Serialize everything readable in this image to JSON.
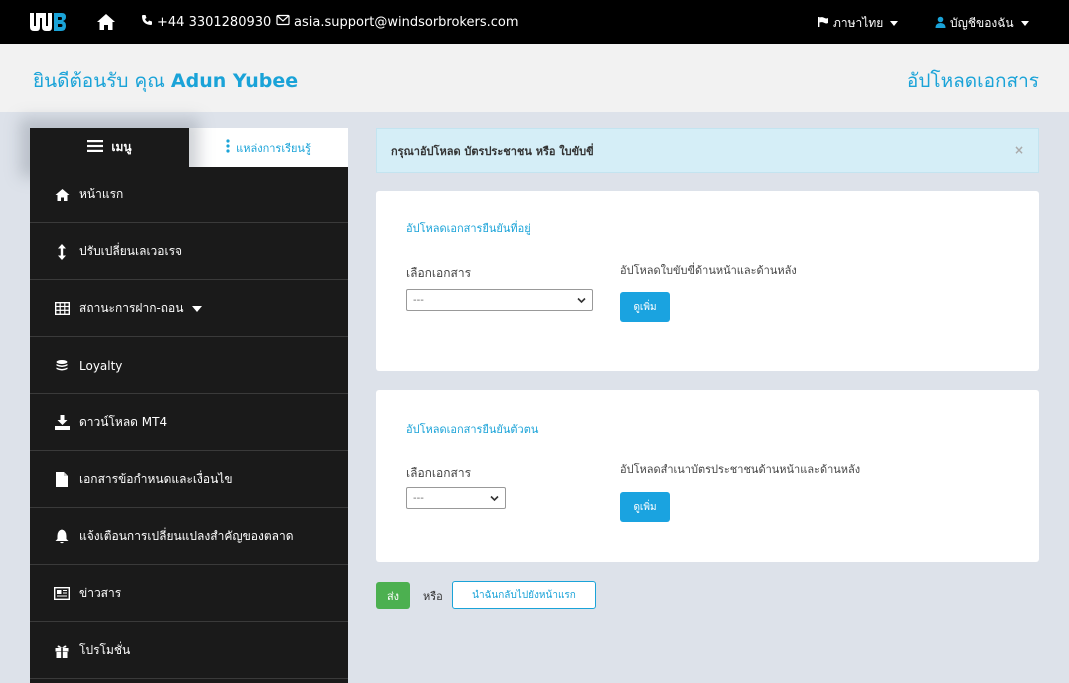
{
  "topbar": {
    "logo_text": "WB",
    "phone": "+44 3301280930",
    "email": "asia.support@windsorbrokers.com",
    "language": "ภาษาไทย",
    "account": "บัญชีของฉัน"
  },
  "welcome": {
    "greeting": "ยินดีต้อนรับ คุณ",
    "name": "Adun Yubee",
    "page_title": "อัปโหลดเอกสาร"
  },
  "sidebar": {
    "tab_menu": "เมนู",
    "tab_learning": "แหล่งการเรียนรู้",
    "items": [
      {
        "label": "หน้าแรก",
        "icon": "home-icon"
      },
      {
        "label": "ปรับเปลี่ยนเลเวอเรจ",
        "icon": "vertical-arrows-icon"
      },
      {
        "label": "สถานะการฝาก-ถอน",
        "icon": "table-icon"
      },
      {
        "label": "Loyalty",
        "icon": "coins-icon"
      },
      {
        "label": "ดาวน์โหลด MT4",
        "icon": "download-icon"
      },
      {
        "label": "เอกสารข้อกำหนดและเงื่อนไข",
        "icon": "file-icon"
      },
      {
        "label": "แจ้งเตือนการเปลี่ยนแปลงสำคัญของตลาด",
        "icon": "bell-icon"
      },
      {
        "label": "ข่าวสาร",
        "icon": "newspaper-icon"
      },
      {
        "label": "โปรโมชั่น",
        "icon": "gift-icon"
      }
    ]
  },
  "alert": {
    "message": "กรุณาอัปโหลด บัตรประชาชน หรือ ใบขับขี่",
    "close": "×"
  },
  "cards": [
    {
      "title": "อัปโหลดเอกสารยืนยันที่อยู่",
      "select_label": "เลือกเอกสาร",
      "select_value": "---",
      "upload_label": "อัปโหลดใบขับขี่ด้านหน้าและด้านหลัง",
      "button": "ดูเพิ่ม"
    },
    {
      "title": "อัปโหลดเอกสารยืนยันตัวตน",
      "select_label": "เลือกเอกสาร",
      "select_value": "---",
      "upload_label": "อัปโหลดสำเนาบัตรประชาชนด้านหน้าและด้านหลัง",
      "button": "ดูเพิ่ม"
    }
  ],
  "actions": {
    "send": "ส่ง",
    "or": "หรือ",
    "back": "นำฉันกลับไปยังหน้าแรก"
  },
  "colors": {
    "accent": "#1aa3d8",
    "topbar": "#000000",
    "sidebar": "#1a1a1a",
    "send": "#4cb050"
  }
}
